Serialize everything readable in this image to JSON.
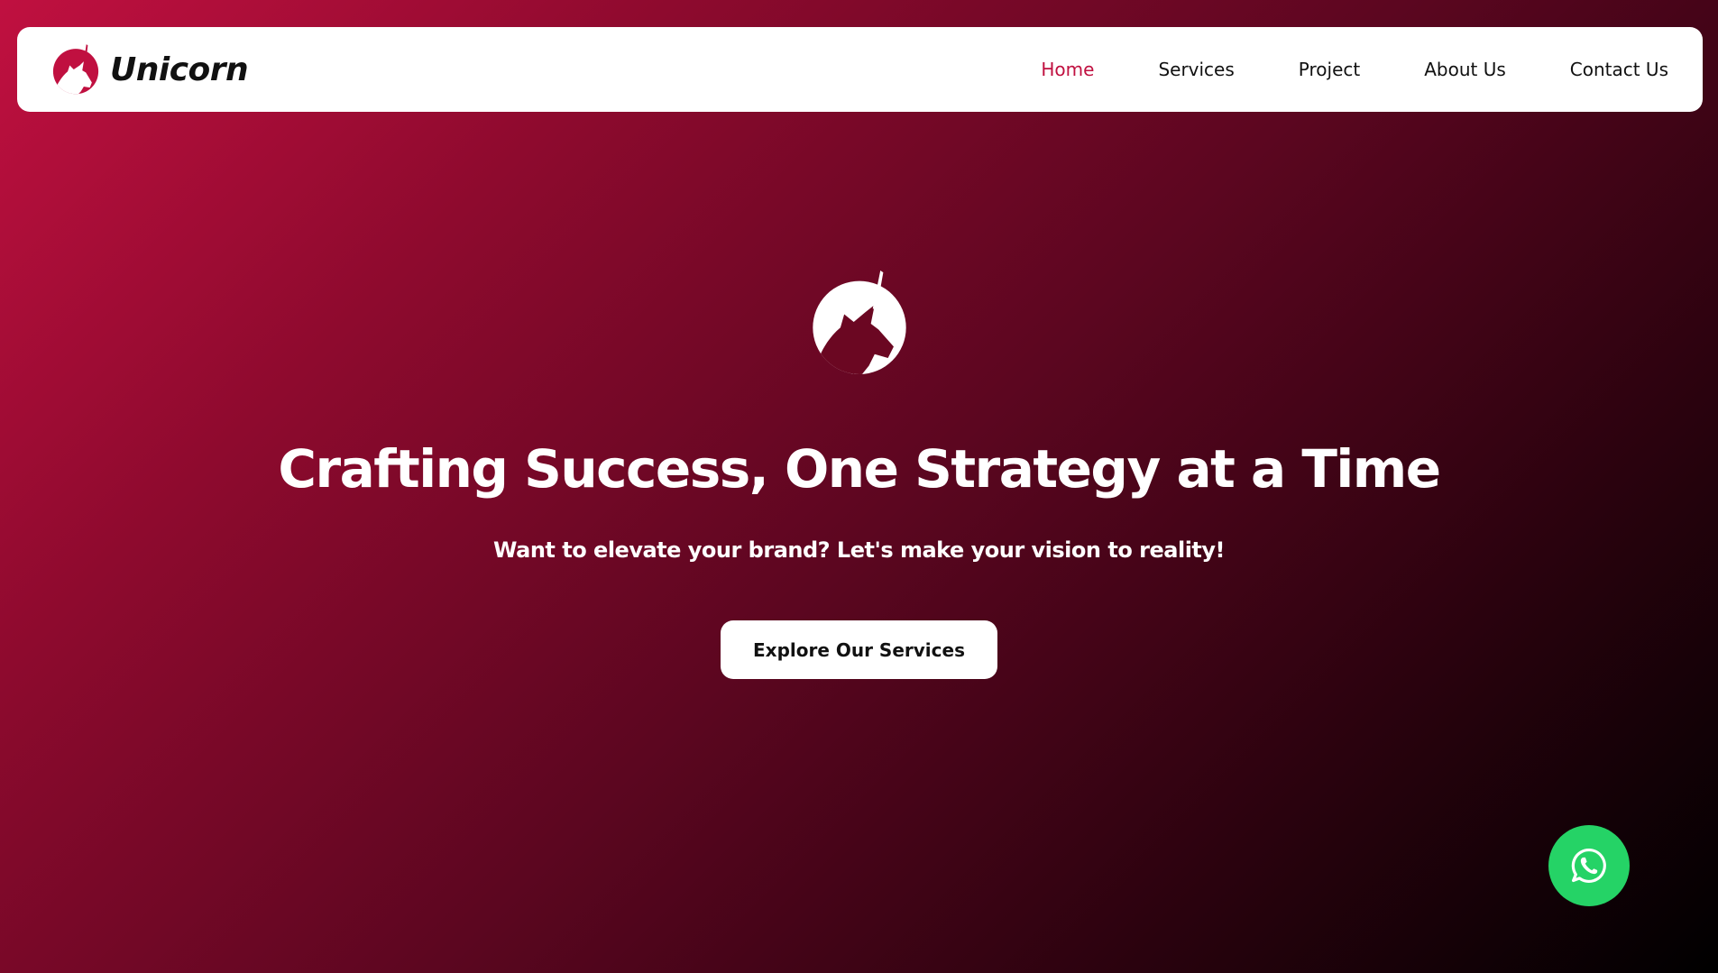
{
  "brand": {
    "name": "Unicorn",
    "logo_icon": "unicorn-head-icon",
    "accent_color": "#c01040"
  },
  "nav": {
    "items": [
      {
        "label": "Home",
        "active": true
      },
      {
        "label": "Services",
        "active": false
      },
      {
        "label": "Project",
        "active": false
      },
      {
        "label": "About Us",
        "active": false
      },
      {
        "label": "Contact Us",
        "active": false
      }
    ]
  },
  "hero": {
    "icon": "unicorn-head-icon",
    "title": "Crafting Success, One Strategy at a Time",
    "subtitle": "Want to elevate your brand? Let's make your vision to reality!",
    "cta_label": "Explore Our Services"
  },
  "floating": {
    "whatsapp_icon": "whatsapp-icon",
    "whatsapp_color": "#25d366"
  },
  "colors": {
    "gradient_start": "#c01040",
    "gradient_end": "#000000",
    "text_light": "#ffffff",
    "text_dark": "#111111"
  }
}
